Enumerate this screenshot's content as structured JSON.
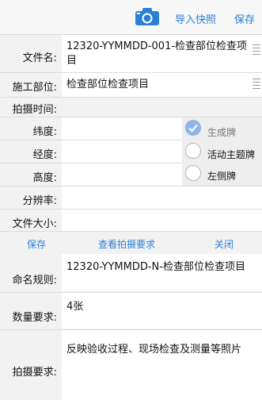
{
  "toolbar": {
    "camera_icon": "camera-icon",
    "import_label": "导入快照",
    "save_label": "保存",
    "accent": "#2b7fd6"
  },
  "form": {
    "file_name": {
      "label": "文件名:",
      "value": "12320-YYMMDD-001-检查部位检查项目"
    },
    "site": {
      "label": "施工部位:",
      "value": "检查部位检查项目"
    },
    "shoot_time": {
      "label": "拍摄时间:"
    },
    "latitude": {
      "label": "纬度:"
    },
    "longitude": {
      "label": "经度:"
    },
    "altitude": {
      "label": "高度:"
    },
    "resolution": {
      "label": "分辨率:"
    },
    "file_size": {
      "label": "文件大小:"
    }
  },
  "options": [
    {
      "label": "生成牌",
      "checked": true
    },
    {
      "label": "活动主题牌",
      "checked": false
    },
    {
      "label": "左侧牌",
      "checked": false
    }
  ],
  "actions": {
    "save": "保存",
    "view_requirements": "查看拍摄要求",
    "close": "关闭"
  },
  "requirements": {
    "naming_rule": {
      "label": "命名规则:",
      "value": "12320-YYMMDD-N-检查部位检查项目"
    },
    "quantity": {
      "label": "数量要求:",
      "value": "4张"
    },
    "shooting": {
      "label": "拍摄要求:",
      "value": "反映验收过程、现场检查及测量等照片"
    }
  }
}
